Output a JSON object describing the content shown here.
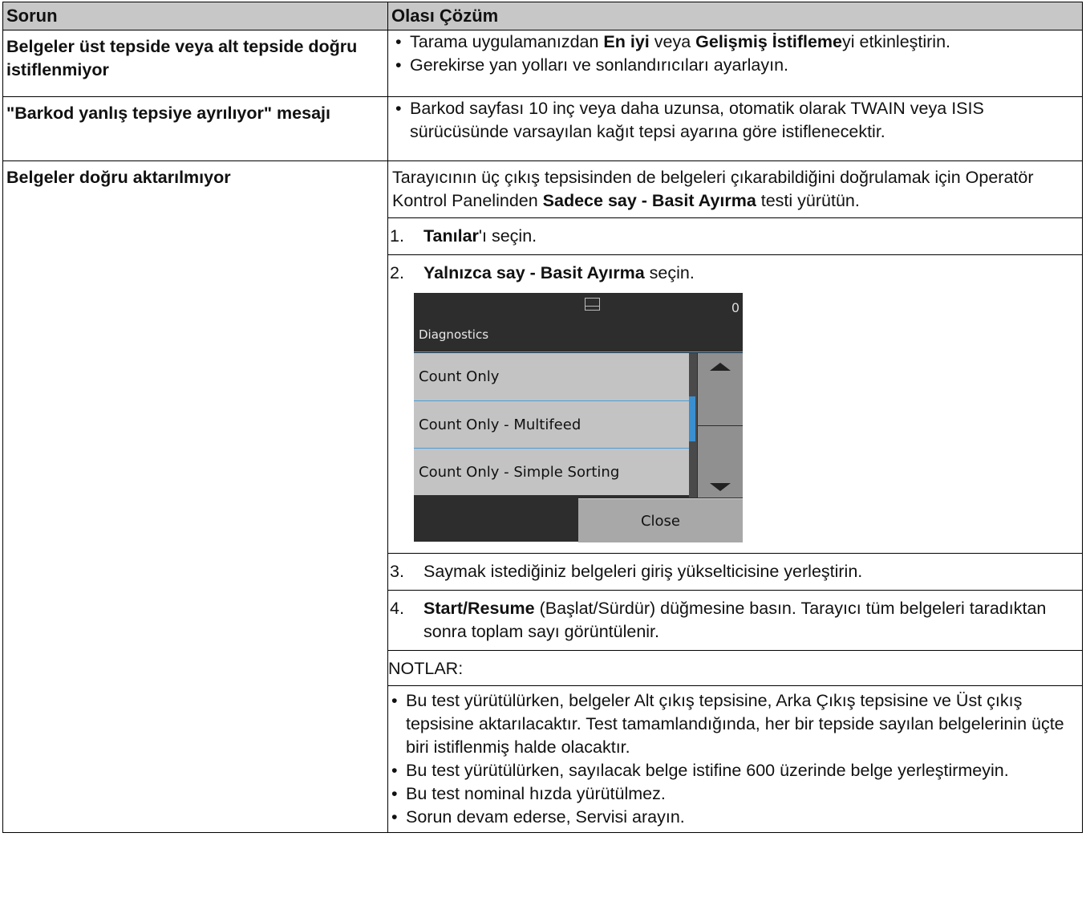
{
  "header": {
    "col1": "Sorun",
    "col2": "Olası Çözüm"
  },
  "row1": {
    "problem": "Belgeler üst tepside veya alt tepside doğru istiflenmiyor",
    "b1_pre": "Tarama uygulamanızdan ",
    "b1_bold1": "En iyi",
    "b1_mid": " veya ",
    "b1_bold2": "Gelişmiş İstifleme",
    "b1_post": "yi etkinleştirin.",
    "b2": "Gerekirse yan yolları ve sonlandırıcıları ayarlayın."
  },
  "row2": {
    "problem": "\"Barkod yanlış tepsiye ayrılıyor\" mesajı",
    "b1": "Barkod sayfası 10 inç veya daha uzunsa, otomatik olarak TWAIN veya ISIS sürücüsünde varsayılan kağıt tepsi ayarına göre istiflenecektir."
  },
  "row3": {
    "problem": "Belgeler doğru aktarılmıyor",
    "intro_pre": "Tarayıcının üç çıkış tepsisinden de belgeleri çıkarabildiğini doğrulamak için Operatör Kontrol Panelinden ",
    "intro_bold": "Sadece say - Basit Ayırma",
    "intro_post": " testi yürütün.",
    "step1_num": "1.",
    "step1_bold": "Tanılar",
    "step1_post": "'ı seçin.",
    "step2_num": "2.",
    "step2_bold": "Yalnızca say - Basit Ayırma",
    "step2_post": " seçin.",
    "step3_num": "3.",
    "step3": "Saymak istediğiniz belgeleri giriş yükselticisine yerleştirin.",
    "step4_num": "4.",
    "step4_bold": "Start/Resume",
    "step4_post": " (Başlat/Sürdür) düğmesine basın. Tarayıcı tüm belgeleri taradıktan sonra toplam sayı görüntülenir.",
    "notes_title": "NOTLAR:",
    "notes": [
      "Bu test yürütülürken, belgeler Alt çıkış tepsisine, Arka Çıkış tepsisine ve Üst çıkış tepsisine aktarılacaktır. Test tamamlandığında, her bir tepside sayılan belgelerinin üçte biri istiflenmiş halde olacaktır.",
      "Bu test yürütülürken, sayılacak belge istifine 600 üzerinde belge yerleştirmeyin.",
      "Bu test nominal hızda yürütülmez.",
      "Sorun devam ederse, Servisi arayın."
    ]
  },
  "screen": {
    "count": "0",
    "title": "Diagnostics",
    "items": [
      "Count Only",
      "Count Only - Multifeed",
      "Count Only - Simple Sorting"
    ],
    "close_label": "Close",
    "colors": {
      "background": "#2d2d2d",
      "accent": "#4a9fd8",
      "item": "#c3c3c3"
    }
  }
}
